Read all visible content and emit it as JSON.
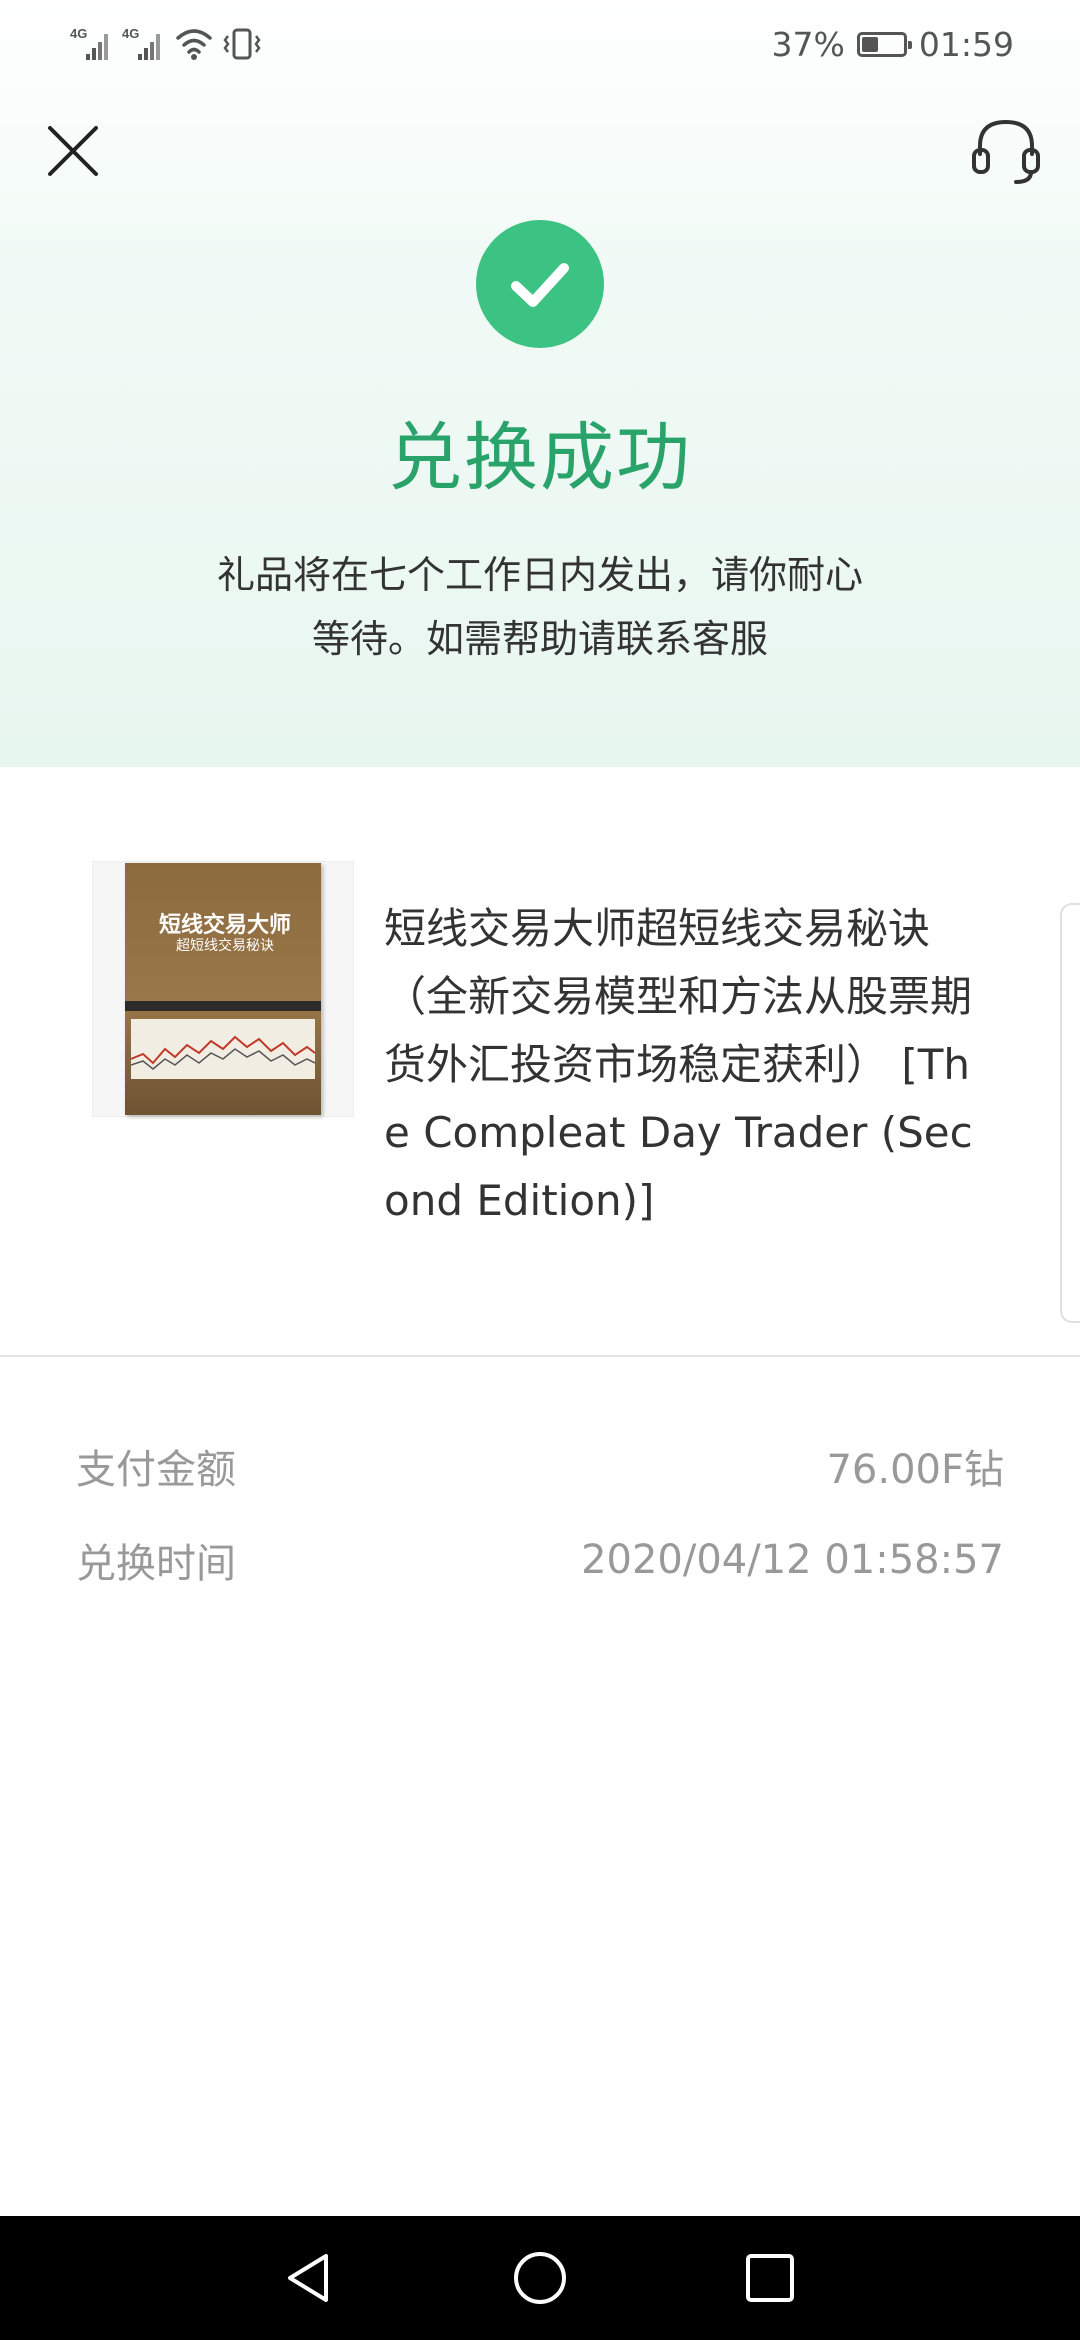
{
  "status_bar": {
    "signal_1_label": "4G",
    "signal_2_label": "4G",
    "battery_percent": "37%",
    "battery_level": 0.37,
    "time": "01:59"
  },
  "header": {
    "close_icon": "close-icon",
    "support_icon": "headset-icon"
  },
  "result": {
    "icon": "check-circle-icon",
    "title": "兑换成功",
    "message": "礼品将在七个工作日内发出，请你耐心等待。如需帮助请联系客服"
  },
  "product": {
    "cover_title": "短线交易大师",
    "cover_subtitle": "超短线交易秘诀",
    "name": "短线交易大师超短线交易秘诀（全新交易模型和方法从股票期货外汇投资市场稳定获利） [The Compleat Day Trader (Second Edition)]"
  },
  "details": {
    "amount_label": "支付金额",
    "amount_value": "76.00F钻",
    "time_label": "兑换时间",
    "time_value": "2020/04/12 01:58:57"
  },
  "nav": {
    "back_icon": "back-triangle-icon",
    "home_icon": "home-circle-icon",
    "recents_icon": "recents-square-icon"
  },
  "colors": {
    "accent": "#3cc283",
    "title_green": "#2aa36b",
    "muted_text": "#999999"
  }
}
